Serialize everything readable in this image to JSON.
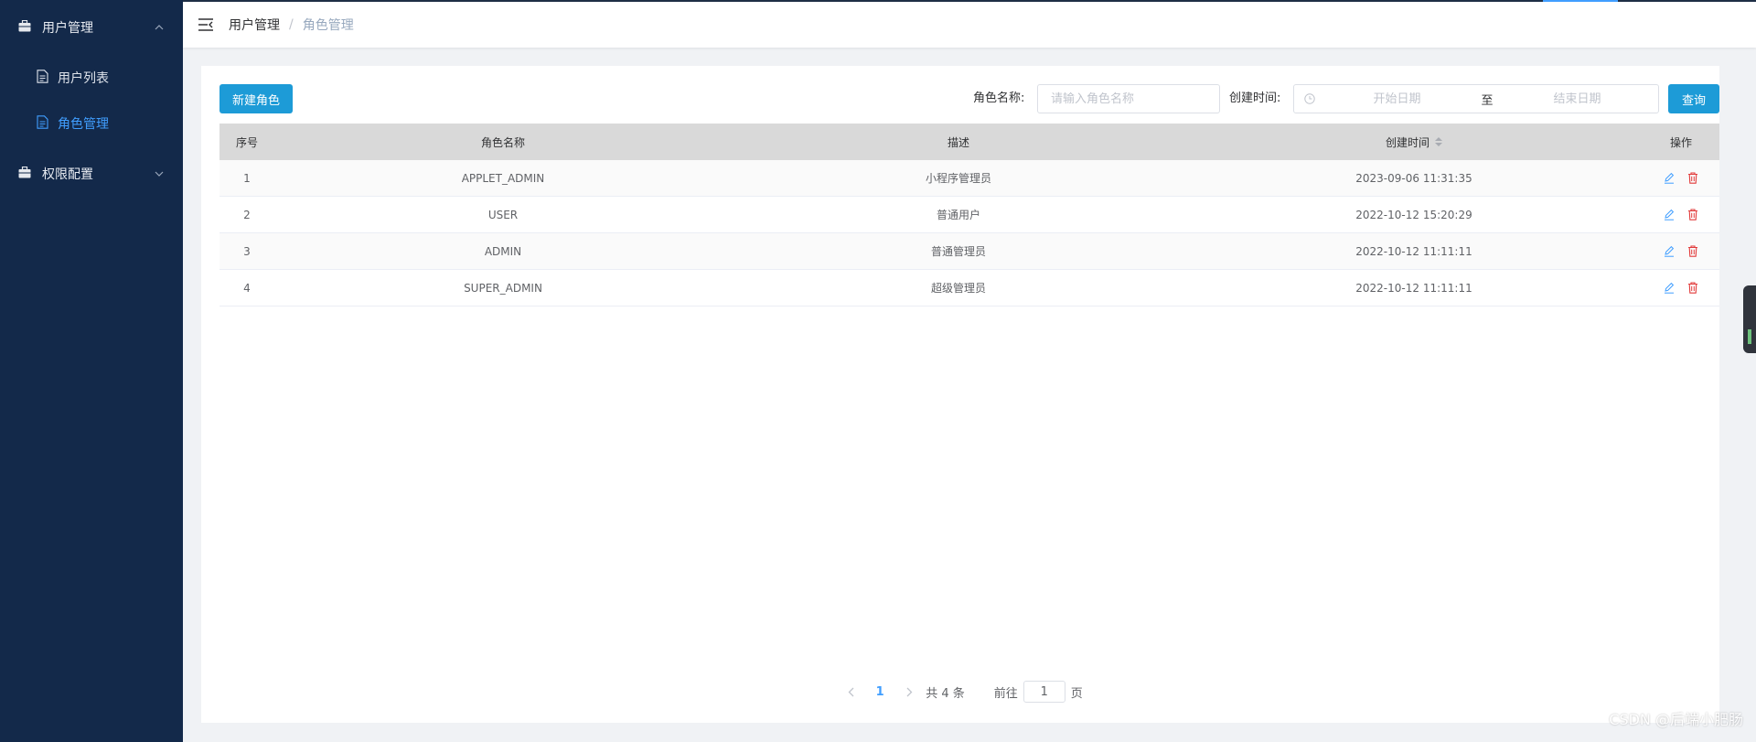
{
  "sidebar": {
    "groups": [
      {
        "label": "用户管理",
        "expanded": true,
        "items": [
          {
            "label": "用户列表",
            "active": false
          },
          {
            "label": "角色管理",
            "active": true
          }
        ]
      },
      {
        "label": "权限配置",
        "expanded": false,
        "items": []
      }
    ]
  },
  "header": {
    "breadcrumb": [
      "用户管理",
      "角色管理"
    ],
    "separator": "/"
  },
  "toolbar": {
    "new_label": "新建角色",
    "role_label": "角色名称:",
    "role_placeholder": "请输入角色名称",
    "time_label": "创建时间:",
    "start_placeholder": "开始日期",
    "range_sep": "至",
    "end_placeholder": "结束日期",
    "search_label": "查询"
  },
  "table": {
    "columns": [
      "序号",
      "角色名称",
      "描述",
      "创建时间",
      "操作"
    ],
    "rows": [
      {
        "idx": "1",
        "name": "APPLET_ADMIN",
        "desc": "小程序管理员",
        "time": "2023-09-06 11:31:35"
      },
      {
        "idx": "2",
        "name": "USER",
        "desc": "普通用户",
        "time": "2022-10-12 15:20:29"
      },
      {
        "idx": "3",
        "name": "ADMIN",
        "desc": "普通管理员",
        "time": "2022-10-12 11:11:11"
      },
      {
        "idx": "4",
        "name": "SUPER_ADMIN",
        "desc": "超级管理员",
        "time": "2022-10-12 11:11:11"
      }
    ]
  },
  "pagination": {
    "current": "1",
    "total_text": "共 4 条",
    "goto_prefix": "前往",
    "goto_value": "1",
    "goto_suffix": "页"
  },
  "watermark": "CSDN @后端小肥肠",
  "colors": {
    "sidebar_bg": "#13294a",
    "primary_button": "#1d9bd7",
    "active_link": "#409eff",
    "delete_icon": "#e23b3b",
    "edit_icon": "#409eff"
  },
  "icons": {
    "group": "briefcase-icon",
    "item": "document-icon",
    "menu_toggle": "menu-fold-icon",
    "edit": "edit-icon",
    "delete": "trash-icon"
  }
}
